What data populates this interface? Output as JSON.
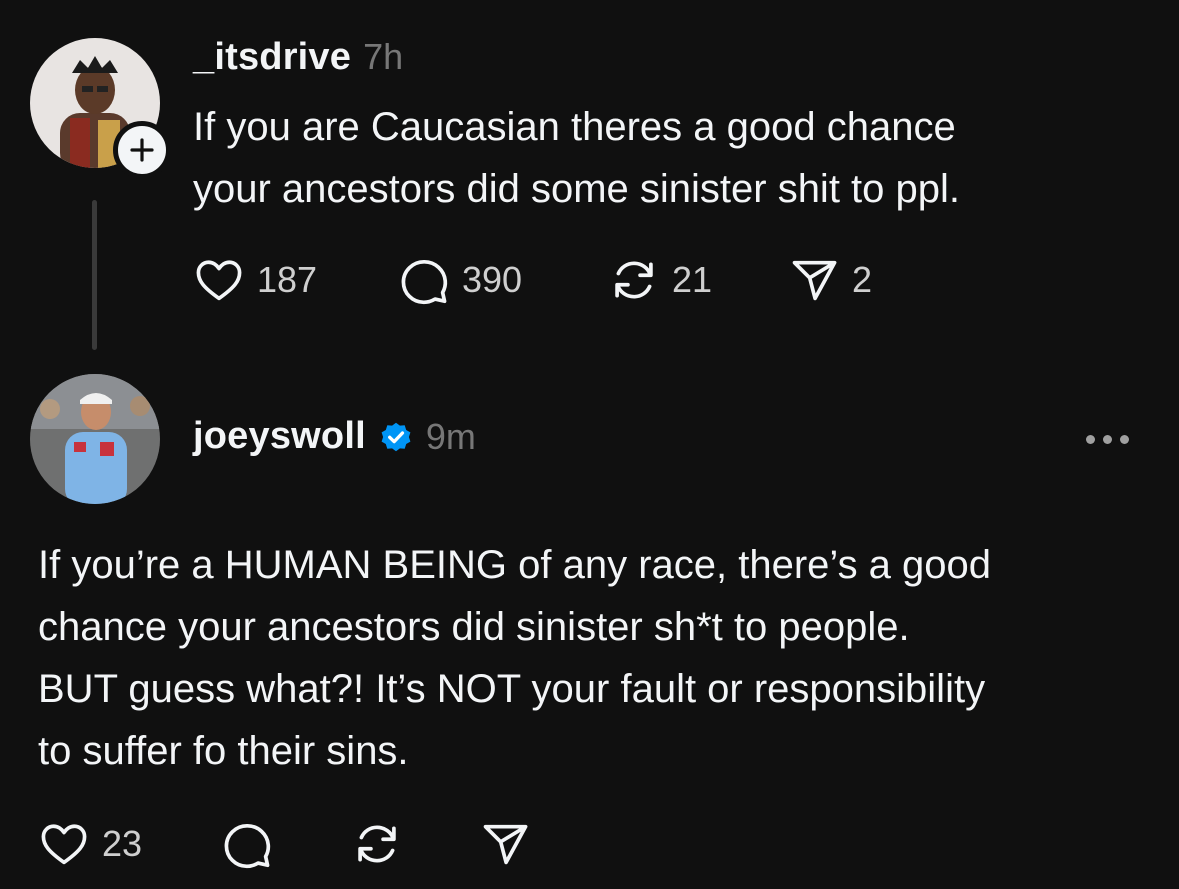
{
  "post1": {
    "username": "_itsdrive",
    "time": "7h",
    "text_line1": "If you are Caucasian theres a good chance",
    "text_line2": "your ancestors did some sinister shit to ppl.",
    "likes": "187",
    "replies": "390",
    "reposts": "21",
    "shares": "2",
    "follow_icon": "plus-icon"
  },
  "post2": {
    "username": "joeyswoll",
    "verified_icon": "verified-badge-icon",
    "verified_color": "#0095f6",
    "time": "9m",
    "text_line1": "If you’re a HUMAN BEING of any race, there’s a good",
    "text_line2": "chance your ancestors did sinister sh*t to people.",
    "text_line3": "BUT guess what?! It’s NOT your fault or responsibility",
    "text_line4": "to suffer fo their sins.",
    "likes": "23"
  },
  "colors": {
    "background": "#101010",
    "text": "#f3f5f7",
    "muted": "#777777"
  }
}
